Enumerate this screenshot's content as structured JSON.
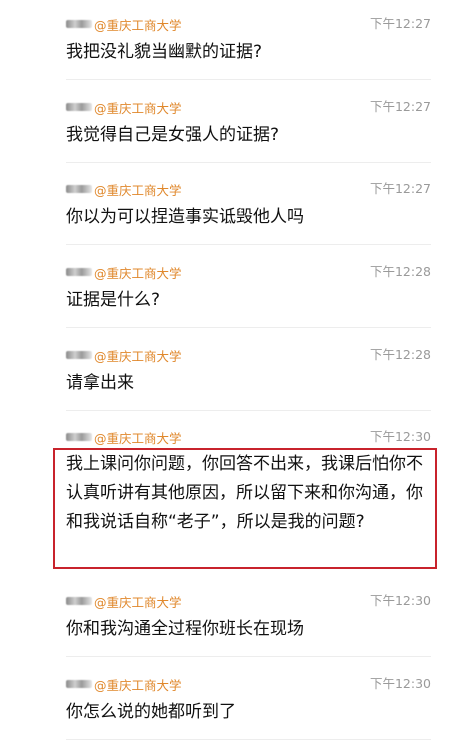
{
  "messages": [
    {
      "sender": "@重庆工商大学",
      "time": "下午12:27",
      "text": "我把没礼貌当幽默的证据?"
    },
    {
      "sender": "@重庆工商大学",
      "time": "下午12:27",
      "text": "我觉得自己是女强人的证据?"
    },
    {
      "sender": "@重庆工商大学",
      "time": "下午12:27",
      "text": "你以为可以捏造事实诋毁他人吗"
    },
    {
      "sender": "@重庆工商大学",
      "time": "下午12:28",
      "text": "证据是什么?"
    },
    {
      "sender": "@重庆工商大学",
      "time": "下午12:28",
      "text": "请拿出来"
    },
    {
      "sender": "@重庆工商大学",
      "time": "下午12:30",
      "text": "我上课问你问题，你回答不出来，我课后怕你不认真听讲有其他原因，所以留下来和你沟通，你和我说话自称“老子”，所以是我的问题?"
    },
    {
      "sender": "@重庆工商大学",
      "time": "下午12:30",
      "text": "你和我沟通全过程你班长在现场"
    },
    {
      "sender": "@重庆工商大学",
      "time": "下午12:30",
      "text": "你怎么说的她都听到了"
    }
  ],
  "colors": {
    "sender": "#e0882c",
    "time": "#9a9a9a",
    "highlight": "#c8232c"
  }
}
